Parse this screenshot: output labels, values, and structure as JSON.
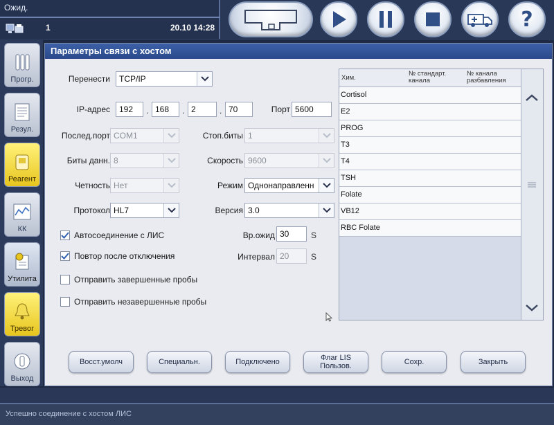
{
  "header": {
    "status_text": "Ожид.",
    "counter": "1",
    "datetime": "20.10 14:28"
  },
  "sidebar": {
    "items": [
      {
        "label": "Прогр.",
        "style": "grey"
      },
      {
        "label": "Резул.",
        "style": "grey"
      },
      {
        "label": "Реагент",
        "style": "yellow"
      },
      {
        "label": "КК",
        "style": "grey"
      },
      {
        "label": "Утилита",
        "style": "selected"
      },
      {
        "label": "Тревог",
        "style": "yellow"
      },
      {
        "label": "Выход",
        "style": "grey"
      }
    ]
  },
  "window": {
    "title": "Параметры связи с хостом"
  },
  "form": {
    "transfer_label": "Перенести",
    "transfer_value": "TCP/IP",
    "ip_label": "IP-адрес",
    "ip": [
      "192",
      "168",
      "2",
      "70"
    ],
    "port_label": "Порт",
    "port_value": "5600",
    "serial_port_label": "Послед.порт",
    "serial_port_value": "COM1",
    "stop_bits_label": "Стоп.биты",
    "stop_bits_value": "1",
    "data_bits_label": "Биты данн.",
    "data_bits_value": "8",
    "speed_label": "Скорость",
    "speed_value": "9600",
    "parity_label": "Четность",
    "parity_value": "Нет",
    "mode_label": "Режим",
    "mode_value": "Однонаправленн",
    "protocol_label": "Протокол",
    "protocol_value": "HL7",
    "version_label": "Версия",
    "version_value": "3.0",
    "autoconnect_label": "Автосоединение с ЛИС",
    "autoconnect_checked": true,
    "reconnect_label": "Повтор после отключения",
    "reconnect_checked": true,
    "send_completed_label": "Отправить завершенные пробы",
    "send_completed_checked": false,
    "send_incomplete_label": "Отправить незавершенные пробы",
    "send_incomplete_checked": false,
    "wait_time_label": "Вр.ожид",
    "wait_time_value": "30",
    "wait_time_unit": "S",
    "interval_label": "Интервал",
    "interval_value": "20",
    "interval_unit": "S"
  },
  "table": {
    "headers": [
      "Хим.",
      "№ стандарт. канала",
      "№ канала разбавления"
    ],
    "rows": [
      "Cortisol",
      "E2",
      "PROG",
      "T3",
      "T4",
      "TSH",
      "Folate",
      "VB12",
      "RBC Folate"
    ]
  },
  "buttons": {
    "restore_defaults": "Восст.умолч",
    "special": "Специальн.",
    "connected": "Подключено",
    "lis_flag_line1": "Флаг LIS",
    "lis_flag_line2": "Пользов.",
    "save": "Сохр.",
    "close": "Закрыть"
  },
  "status_message": "Успешно соединение с хостом ЛИС"
}
